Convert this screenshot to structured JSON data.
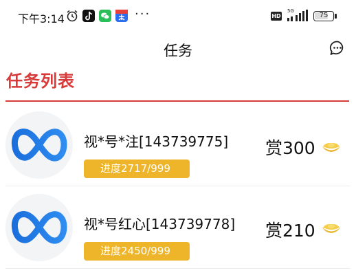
{
  "status_bar": {
    "time": "下午3:14",
    "network": "5G",
    "hd": "HD",
    "battery": "75",
    "battery_level": 75,
    "more": "···"
  },
  "header": {
    "title": "任务"
  },
  "section": {
    "title": "任务列表"
  },
  "tasks": [
    {
      "title": "视*号*注[143739775]",
      "progress": "进度2717/999",
      "reward": "赏300"
    },
    {
      "title": "视*号红心[143739778]",
      "progress": "进度2450/999",
      "reward": "赏210"
    }
  ],
  "colors": {
    "accent_red": "#d83a3a",
    "progress_bg": "#efb52a",
    "ingot": "#f2c23a",
    "logo_blue": "#1f7ae0"
  },
  "icons": {
    "alarm": "alarm-icon",
    "tiktok": "tiktok-icon",
    "wechat": "wechat-icon",
    "chat": "chat-bubble-icon",
    "logo": "meta-infinity-logo-icon",
    "ingot": "gold-ingot-icon"
  }
}
